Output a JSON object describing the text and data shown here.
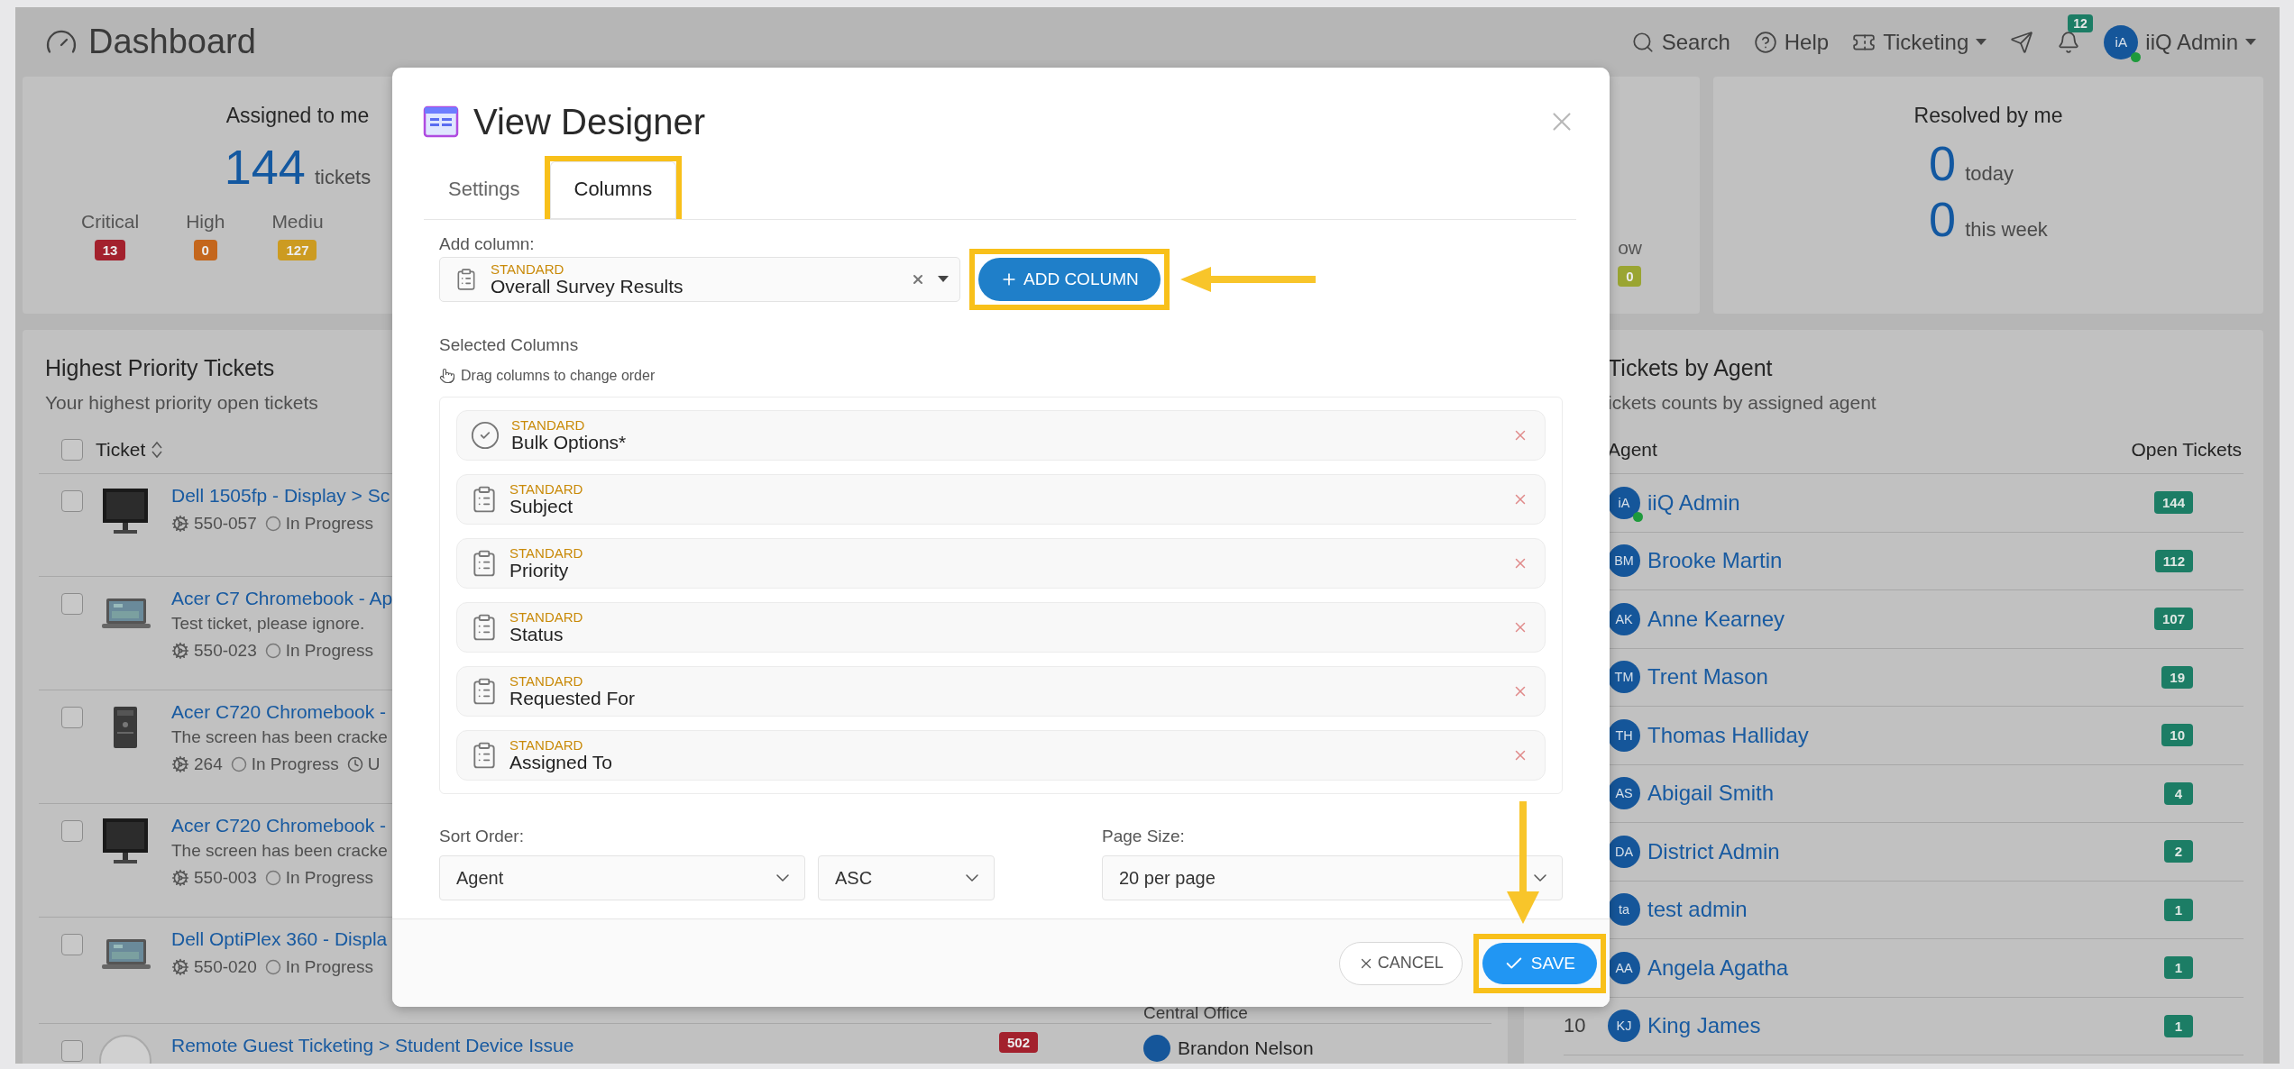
{
  "header": {
    "title": "Dashboard",
    "nav": [
      {
        "kind": "search",
        "label": "Search"
      },
      {
        "kind": "help",
        "label": "Help"
      },
      {
        "kind": "ticketing",
        "label": "Ticketing"
      },
      {
        "kind": "send"
      },
      {
        "kind": "bell",
        "badge": "12"
      }
    ],
    "user": {
      "initials": "iA",
      "name": "iiQ Admin",
      "online": true
    }
  },
  "assigned_card": {
    "title": "Assigned to me",
    "count": "144",
    "unit": "tickets",
    "priorities": [
      {
        "label": "Critical",
        "count": "13",
        "color": "#a3212d"
      },
      {
        "label": "High",
        "count": "0",
        "color": "#c4661c"
      },
      {
        "label": "Mediu",
        "count": "127",
        "color": "#cc9b21"
      }
    ]
  },
  "partial_card": {
    "priorities": [
      {
        "label": "ow",
        "count": "0",
        "color": "#9aa532"
      }
    ]
  },
  "resolved_card": {
    "title": "Resolved by me",
    "stats": [
      {
        "value": "0",
        "unit": "today"
      },
      {
        "value": "0",
        "unit": "this week"
      }
    ]
  },
  "tickets_panel": {
    "title": "Highest Priority Tickets",
    "subtitle": "Your highest priority open tickets",
    "column": "Ticket",
    "all_checked": false,
    "rows": [
      {
        "checked": false,
        "title": "Dell 1505fp - Display > Sc",
        "number": "550-057",
        "status": "In Progress"
      },
      {
        "checked": false,
        "title": "Acer C7 Chromebook - Ap",
        "description": "Test ticket, please ignore.",
        "number": "550-023",
        "status": "In Progress"
      },
      {
        "checked": false,
        "title": "Acer C720 Chromebook -",
        "description": "The screen has been cracke",
        "number": "264",
        "status": "In Progress",
        "extra": "U"
      },
      {
        "checked": false,
        "title": "Acer C720 Chromebook -",
        "description": "The screen has been cracke",
        "number": "550-003",
        "status": "In Progress"
      },
      {
        "checked": false,
        "title": "Dell OptiPlex 360 - Displa",
        "number": "550-020",
        "status": "In Progress",
        "location": "Central Office"
      },
      {
        "checked": false,
        "title": "Remote Guest Ticketing > Student Device Issue",
        "badge": "502",
        "agent": "Brandon Nelson"
      }
    ]
  },
  "agents_panel": {
    "title": "Tickets by Agent",
    "subtitle": "ickets counts by assigned agent",
    "columns": [
      "Agent",
      "Open Tickets"
    ],
    "agents": [
      {
        "initials": "iA",
        "name": "iiQ Admin",
        "count": "144",
        "online": true
      },
      {
        "initials": "BM",
        "name": "Brooke Martin",
        "count": "112",
        "online": false
      },
      {
        "initials": "AK",
        "name": "Anne Kearney",
        "count": "107",
        "online": false
      },
      {
        "initials": "TM",
        "name": "Trent Mason",
        "count": "19",
        "online": false
      },
      {
        "initials": "TH",
        "name": "Thomas Halliday",
        "count": "10",
        "online": false
      },
      {
        "initials": "AS",
        "name": "Abigail Smith",
        "count": "4",
        "online": false
      },
      {
        "initials": "DA",
        "name": "District Admin",
        "count": "2",
        "online": false
      },
      {
        "initials": "ta",
        "name": "test admin",
        "count": "1",
        "online": false
      },
      {
        "initials": "AA",
        "name": "Angela Agatha",
        "count": "1",
        "online": false
      },
      {
        "rank": "10",
        "initials": "KJ",
        "name": "King James",
        "count": "1",
        "online": false
      }
    ]
  },
  "modal": {
    "title": "View Designer",
    "tabs": [
      {
        "label": "Settings",
        "selected": false,
        "highlighted": false
      },
      {
        "label": "Columns",
        "selected": true,
        "highlighted": true
      }
    ],
    "add_column": {
      "label": "Add column:",
      "selection": {
        "category": "STANDARD",
        "name": "Overall Survey Results"
      },
      "button": {
        "label": "ADD COLUMN",
        "highlighted": true,
        "arrow": true
      }
    },
    "selected_columns": {
      "label": "Selected Columns",
      "hint": "Drag columns to change order",
      "items": [
        {
          "kind": "check",
          "category": "STANDARD",
          "name": "Bulk Options*"
        },
        {
          "kind": "field",
          "category": "STANDARD",
          "name": "Subject"
        },
        {
          "kind": "field",
          "category": "STANDARD",
          "name": "Priority"
        },
        {
          "kind": "field",
          "category": "STANDARD",
          "name": "Status"
        },
        {
          "kind": "field",
          "category": "STANDARD",
          "name": "Requested For"
        },
        {
          "kind": "field",
          "category": "STANDARD",
          "name": "Assigned To"
        }
      ]
    },
    "sort": {
      "label": "Sort Order:",
      "field": "Agent",
      "direction": "ASC"
    },
    "page_size": {
      "label": "Page Size:",
      "value": "20 per page"
    },
    "footer": {
      "cancel": {
        "label": "CANCEL"
      },
      "save": {
        "label": "SAVE",
        "highlighted": true,
        "arrow": true
      }
    }
  }
}
